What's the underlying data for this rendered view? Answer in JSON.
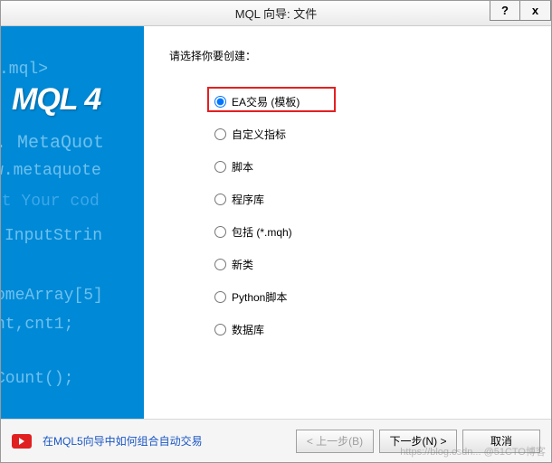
{
  "window": {
    "title": "MQL 向导: 文件",
    "help_btn": "?",
    "close_btn": "x"
  },
  "sidebar": {
    "logo": "MQL 4",
    "code_lines": [
      ".mql>",
      ". MetaQuot",
      "w.metaquote",
      "rt Your cod",
      "InputStrin",
      "omeArray[5]",
      "nt,cnt1;",
      "Count();"
    ]
  },
  "content": {
    "instruction": "请选择你要创建：",
    "options": [
      {
        "label": "EA交易 (模板)",
        "checked": true,
        "highlighted": true,
        "name": "ea-template"
      },
      {
        "label": "自定义指标",
        "checked": false,
        "highlighted": false,
        "name": "custom-indicator"
      },
      {
        "label": "脚本",
        "checked": false,
        "highlighted": false,
        "name": "script"
      },
      {
        "label": "程序库",
        "checked": false,
        "highlighted": false,
        "name": "library"
      },
      {
        "label": "包括 (*.mqh)",
        "checked": false,
        "highlighted": false,
        "name": "include-mqh"
      },
      {
        "label": "新类",
        "checked": false,
        "highlighted": false,
        "name": "new-class"
      },
      {
        "label": "Python脚本",
        "checked": false,
        "highlighted": false,
        "name": "python-script"
      },
      {
        "label": "数据库",
        "checked": false,
        "highlighted": false,
        "name": "database"
      }
    ]
  },
  "footer": {
    "link_text": "在MQL5向导中如何组合自动交易",
    "back_btn": "< 上一步(B)",
    "next_btn": "下一步(N) >",
    "cancel_btn": "取消"
  },
  "watermark": "https://blog.csdn... @51CTO博客"
}
